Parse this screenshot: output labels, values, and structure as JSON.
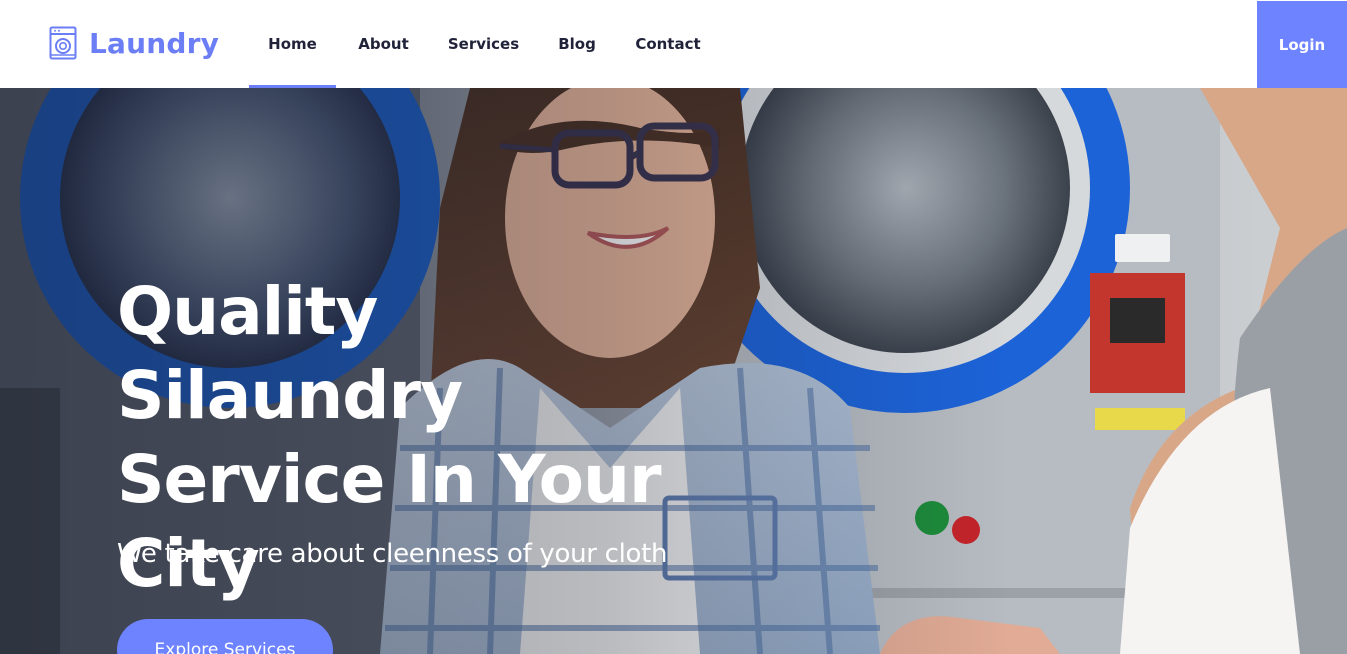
{
  "brand": {
    "name": "Laundry",
    "icon": "washing-machine-icon",
    "color": "#6c7ef5"
  },
  "nav": {
    "items": [
      {
        "label": "Home",
        "active": true
      },
      {
        "label": "About",
        "active": false
      },
      {
        "label": "Services",
        "active": false
      },
      {
        "label": "Blog",
        "active": false
      },
      {
        "label": "Contact",
        "active": false
      }
    ],
    "login_label": "Login"
  },
  "hero": {
    "title": "Quality Silaundry Service In Your City",
    "subtitle": "We take care about cleenness of your cloth",
    "cta_label": "Explore Services",
    "accent_color": "#6d83ff"
  }
}
